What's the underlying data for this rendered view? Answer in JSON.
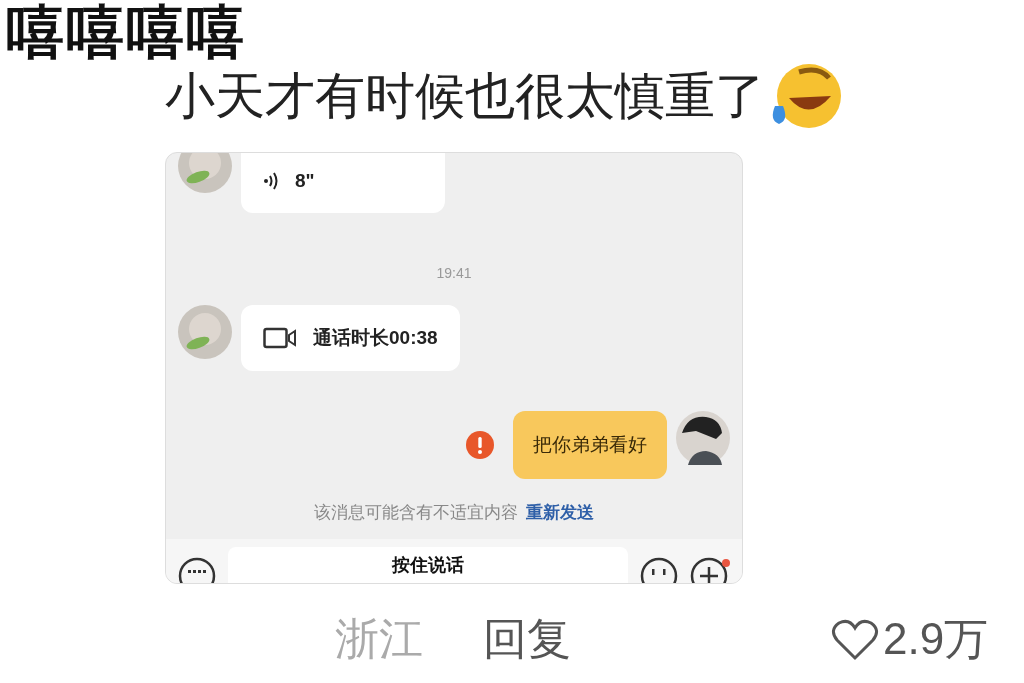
{
  "comment": {
    "username": "嘻嘻嘻嘻",
    "text": "小天才有时候也很太慎重了"
  },
  "chat": {
    "messages": [
      {
        "kind": "voice",
        "outgoing": false,
        "duration": "8\""
      },
      {
        "kind": "time",
        "text": "19:41"
      },
      {
        "kind": "call",
        "outgoing": false,
        "text": "通话时长00:38"
      },
      {
        "kind": "text",
        "outgoing": true,
        "text": "把你弟弟看好",
        "failed": true
      },
      {
        "kind": "notice",
        "text": "该消息可能含有不适宜内容",
        "link": "重新发送"
      }
    ],
    "input": {
      "hold_button": "按住说话",
      "plus_badge": true
    }
  },
  "footer": {
    "location": "浙江",
    "reply": "回复",
    "likes": "2.9万",
    "liked": false
  }
}
